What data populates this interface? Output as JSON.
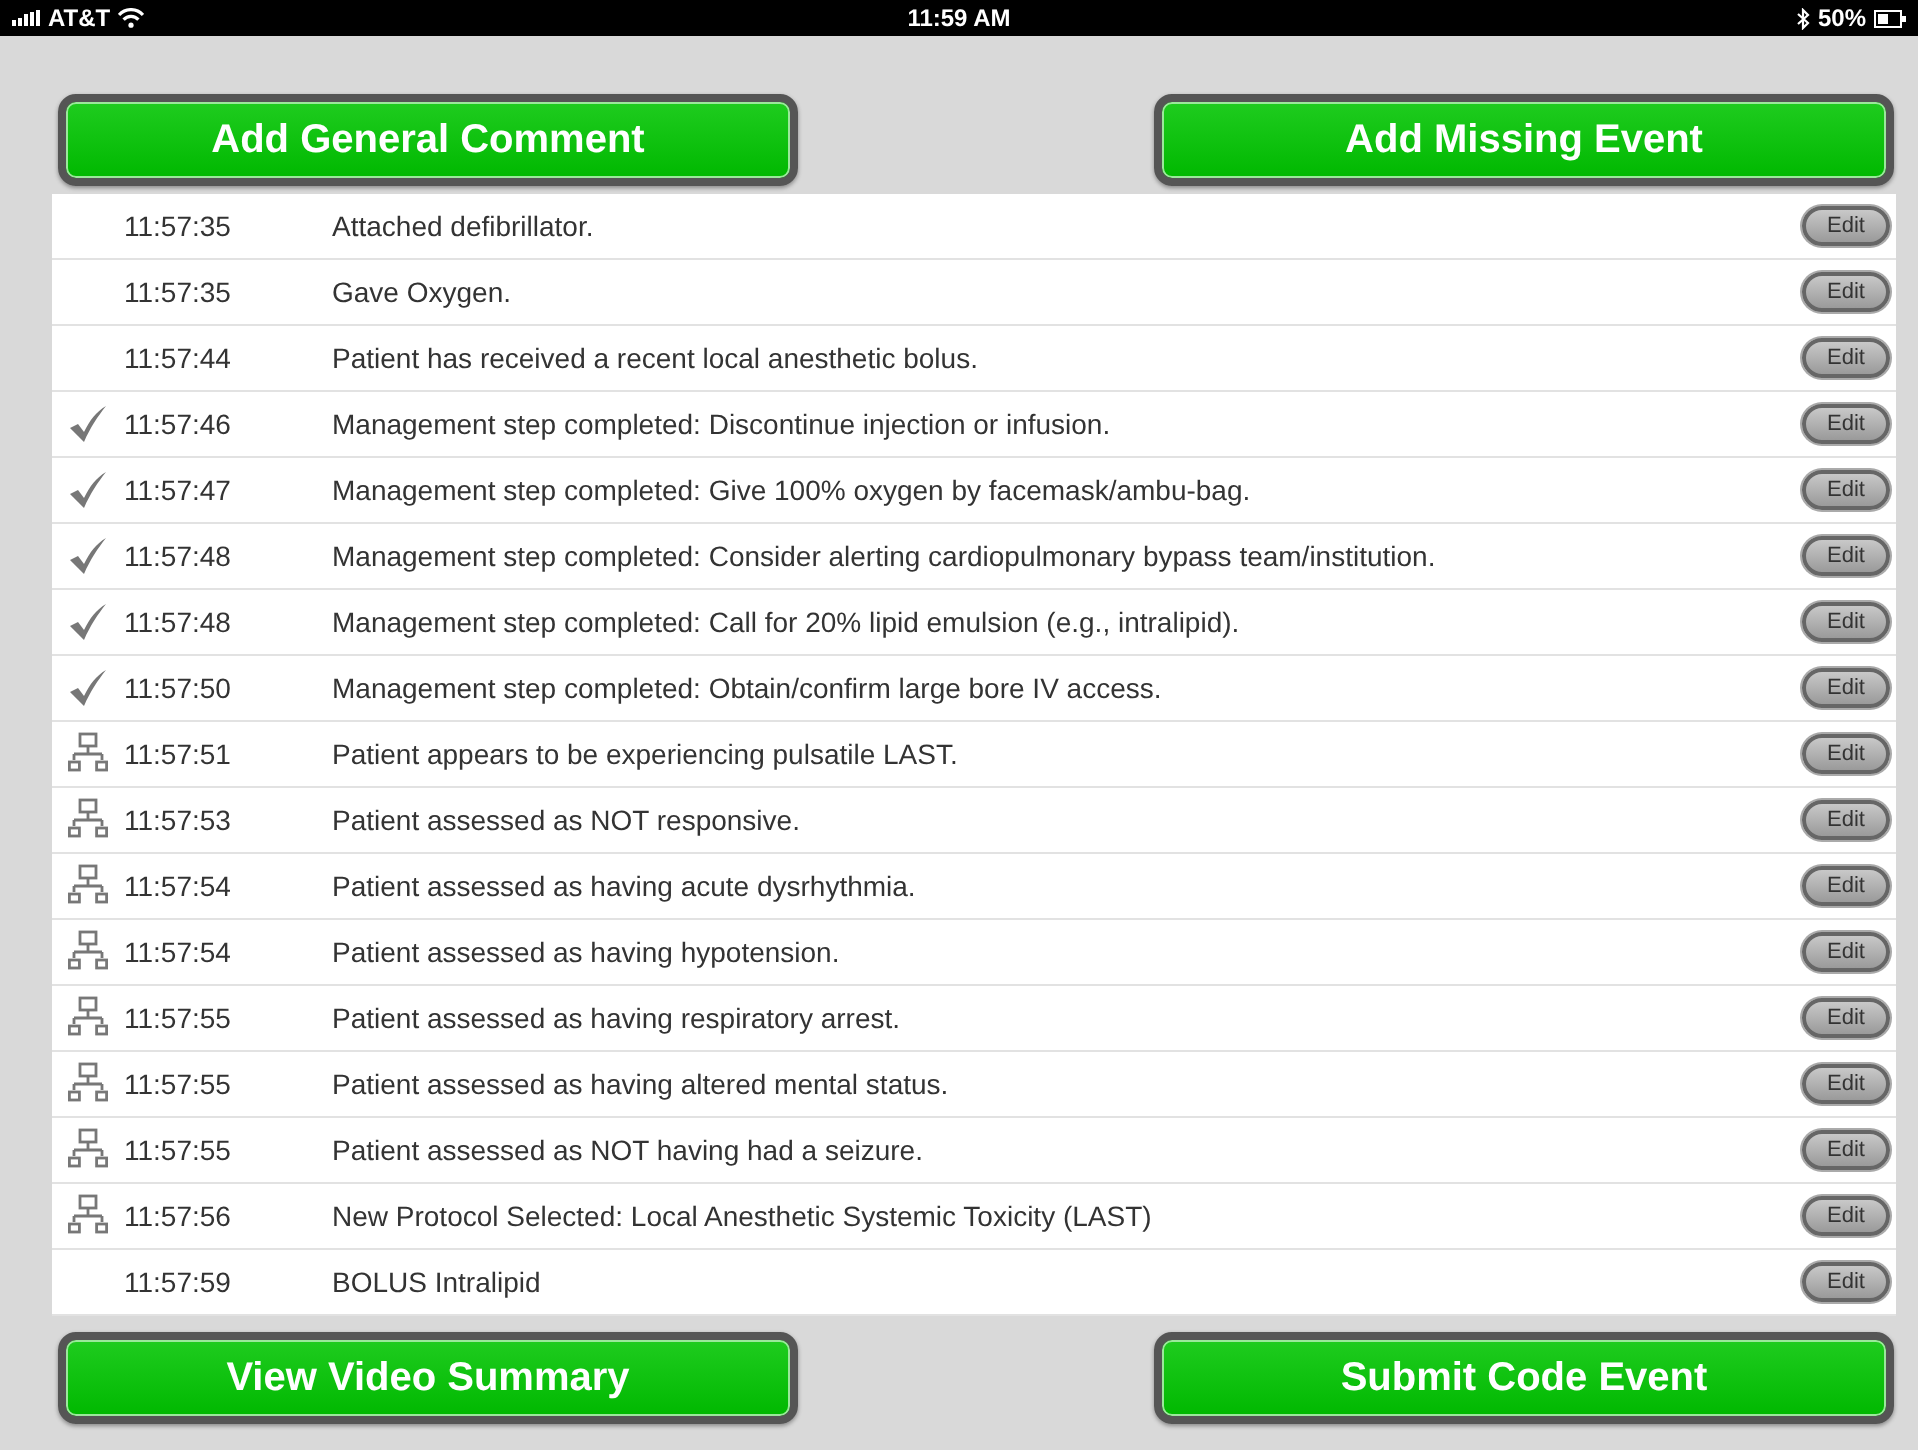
{
  "status_bar": {
    "carrier": "AT&T",
    "time": "11:59 AM",
    "battery": "50%"
  },
  "top_buttons": [
    "Add General Comment",
    "Add Missing Event"
  ],
  "events": [
    {
      "kind": "plain",
      "time": "11:57:35",
      "text": "Attached defibrillator.",
      "action": "Edit"
    },
    {
      "kind": "plain",
      "time": "11:57:35",
      "text": "Gave Oxygen.",
      "action": "Edit"
    },
    {
      "kind": "plain",
      "time": "11:57:44",
      "text": "Patient has received a recent local anesthetic bolus.",
      "action": "Edit"
    },
    {
      "kind": "check",
      "time": "11:57:46",
      "text": "Management step completed: Discontinue injection or infusion.",
      "action": "Edit"
    },
    {
      "kind": "check",
      "time": "11:57:47",
      "text": "Management step completed: Give 100% oxygen by facemask/ambu-bag.",
      "action": "Edit"
    },
    {
      "kind": "check",
      "time": "11:57:48",
      "text": "Management step completed: Consider alerting cardiopulmonary bypass team/institution.",
      "action": "Edit"
    },
    {
      "kind": "check",
      "time": "11:57:48",
      "text": "Management step completed: Call for 20% lipid emulsion (e.g., intralipid).",
      "action": "Edit"
    },
    {
      "kind": "check",
      "time": "11:57:50",
      "text": "Management step completed: Obtain/confirm large bore IV access.",
      "action": "Edit"
    },
    {
      "kind": "protocol",
      "time": "11:57:51",
      "text": "Patient appears to be experiencing pulsatile LAST.",
      "action": "Edit"
    },
    {
      "kind": "protocol",
      "time": "11:57:53",
      "text": "Patient assessed as NOT responsive.",
      "action": "Edit"
    },
    {
      "kind": "protocol",
      "time": "11:57:54",
      "text": "Patient assessed as having acute dysrhythmia.",
      "action": "Edit"
    },
    {
      "kind": "protocol",
      "time": "11:57:54",
      "text": "Patient assessed as having hypotension.",
      "action": "Edit"
    },
    {
      "kind": "protocol",
      "time": "11:57:55",
      "text": "Patient assessed as having respiratory arrest.",
      "action": "Edit"
    },
    {
      "kind": "protocol",
      "time": "11:57:55",
      "text": "Patient assessed as having altered mental status.",
      "action": "Edit"
    },
    {
      "kind": "protocol",
      "time": "11:57:55",
      "text": "Patient assessed as NOT having had a seizure.",
      "action": "Edit"
    },
    {
      "kind": "protocol",
      "time": "11:57:56",
      "text": "New Protocol Selected: Local Anesthetic Systemic Toxicity (LAST)",
      "action": "Edit"
    },
    {
      "kind": "plain",
      "time": "11:57:59",
      "text": "BOLUS Intralipid",
      "action": "Edit"
    }
  ],
  "bottom_buttons": [
    "View Video Summary",
    "Submit Code Event"
  ]
}
